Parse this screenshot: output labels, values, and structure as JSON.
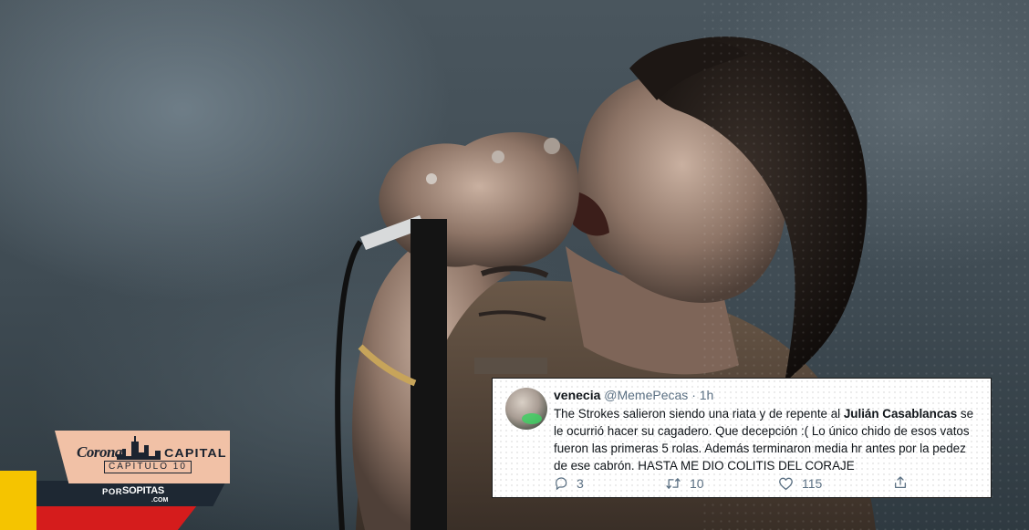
{
  "tweet": {
    "display_name": "venecia",
    "handle": "@MemePecas",
    "separator": "·",
    "time": "1h",
    "text_before": "The Strokes salieron siendo una riata y de repente al ",
    "text_bold": "Julián Casablancas",
    "text_after": " se le ocurrió hacer su cagadero. Que decepción :( Lo único chido de esos vatos fueron las primeras 5 rolas. Además terminaron media hr antes por la pedez de ese cabrón. HASTA ME DIO COLITIS DEL CORAJE",
    "reply_count": "3",
    "retweet_count": "10",
    "like_count": "115"
  },
  "logo": {
    "corona": "Corona",
    "capital": "CAPITAL",
    "capitulo": "CAPÍTULO 10",
    "por": "POR",
    "sopitas": "SOPITAS",
    "com": ".COM"
  },
  "colors": {
    "logo_yellow": "#f5c400",
    "logo_red": "#d51c1c",
    "logo_dark": "#1e2833",
    "logo_peach": "#f1c1a6",
    "tweet_text": "#0f1419",
    "tweet_muted": "#5b7083"
  }
}
